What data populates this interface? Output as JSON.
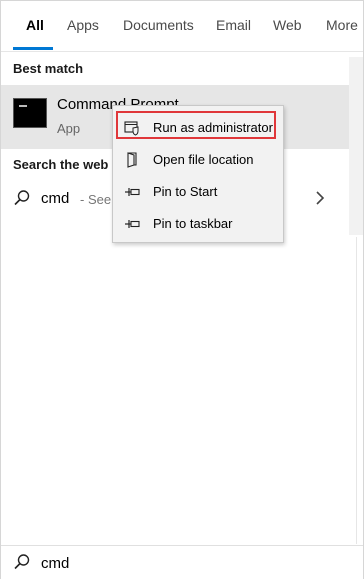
{
  "tabs": [
    {
      "label": "All",
      "active": true
    },
    {
      "label": "Apps"
    },
    {
      "label": "Documents"
    },
    {
      "label": "Email"
    },
    {
      "label": "Web"
    },
    {
      "label": "More"
    }
  ],
  "accent_color": "#0078d4",
  "highlight_color": "#e0373a",
  "best_match": {
    "heading": "Best match",
    "app_name": "Command Prompt",
    "app_type": "App",
    "icon": "command-prompt-icon"
  },
  "web": {
    "heading": "Search the web",
    "query": "cmd",
    "hint": "- See w"
  },
  "context_menu": {
    "items": [
      {
        "label": "Run as administrator",
        "icon": "shield-icon",
        "highlighted": true
      },
      {
        "label": "Open file location",
        "icon": "folder-icon"
      },
      {
        "label": "Pin to Start",
        "icon": "pin-icon"
      },
      {
        "label": "Pin to taskbar",
        "icon": "pin-icon"
      }
    ]
  },
  "search_bar": {
    "value": "cmd",
    "icon": "search-icon"
  }
}
